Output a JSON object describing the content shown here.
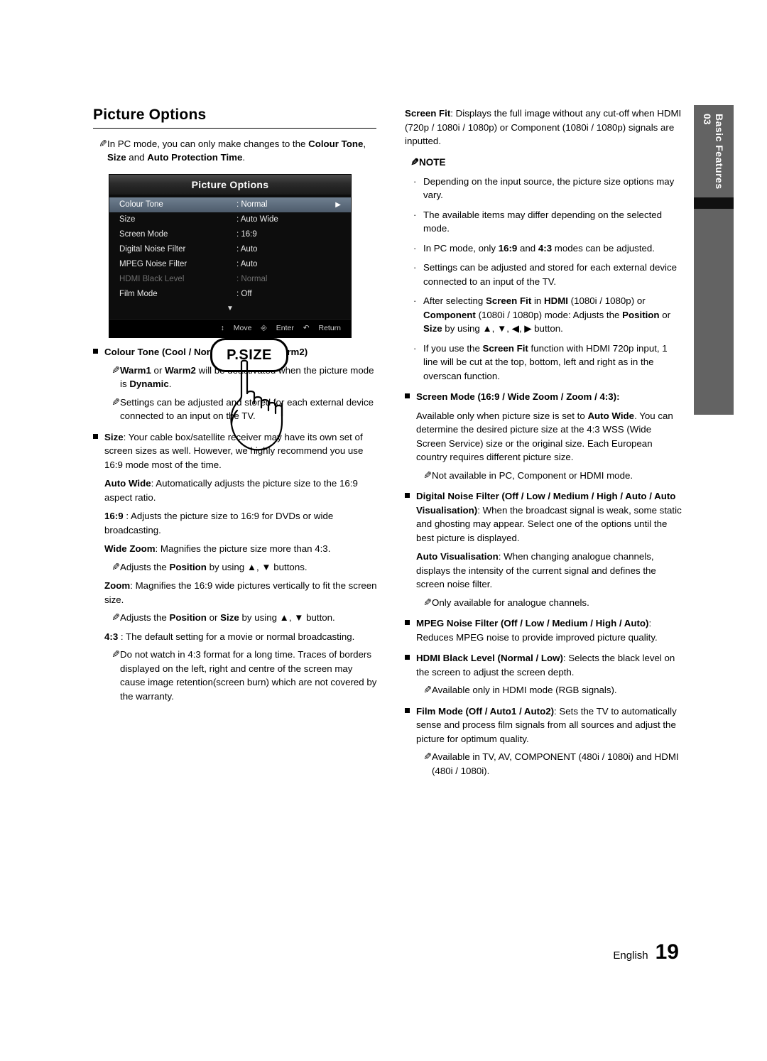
{
  "page": {
    "title": "Picture Options",
    "footer_label": "English",
    "page_number": "19",
    "side_tab_number": "03",
    "side_tab_text": "Basic Features"
  },
  "left": {
    "intro_note": "In PC mode, you can only make changes to the Colour Tone, Size and Auto Protection Time.",
    "osd": {
      "header": "Picture Options",
      "rows": [
        {
          "label": "Colour Tone",
          "value": ": Normal",
          "arrow": "▶",
          "state": "selected"
        },
        {
          "label": "Size",
          "value": ": Auto Wide",
          "arrow": "",
          "state": "normal"
        },
        {
          "label": "Screen Mode",
          "value": ": 16:9",
          "arrow": "",
          "state": "normal"
        },
        {
          "label": "Digital Noise Filter",
          "value": ": Auto",
          "arrow": "",
          "state": "normal"
        },
        {
          "label": "MPEG Noise Filter",
          "value": ": Auto",
          "arrow": "",
          "state": "normal"
        },
        {
          "label": "HDMI Black Level",
          "value": ": Normal",
          "arrow": "",
          "state": "dim"
        },
        {
          "label": "Film Mode",
          "value": ": Off",
          "arrow": "",
          "state": "normal"
        }
      ],
      "scroll_down": "▼",
      "footer": {
        "move": "Move",
        "enter": "Enter",
        "return": "Return"
      }
    },
    "colour_tone": {
      "heading": "Colour Tone (Cool / Normal / Warm1 / Warm2)",
      "note1": "Warm1 or Warm2 will be deactivated when the picture mode is Dynamic.",
      "note2": "Settings can be adjusted and stored for each external device connected to an input on the TV."
    },
    "size": {
      "heading": "Size: Your cable box/satellite receiver may have its own set of screen sizes as well. However, we highly recommend you use 16:9 mode most of the time.",
      "auto_wide": "Auto Wide: Automatically adjusts the picture size to the 16:9 aspect ratio.",
      "ratio_169": "16:9 : Adjusts the picture size to 16:9 for DVDs or wide broadcasting.",
      "wide_zoom": "Wide Zoom: Magnifies the picture size more than 4:3.",
      "wide_zoom_note": "Adjusts the Position by using ▲, ▼ buttons.",
      "zoom": "Zoom: Magnifies the 16:9 wide pictures vertically to fit the screen size.",
      "zoom_note": "Adjusts the Position or Size by using ▲, ▼ button.",
      "ratio_43": "4:3 : The default setting for a movie or normal broadcasting.",
      "ratio_43_note": "Do not watch in 4:3 format for a long time. Traces of borders displayed on the left, right and centre of the screen may cause image retention(screen burn) which are not covered by the warranty."
    },
    "remote_button_label": "P.SIZE"
  },
  "right": {
    "screen_fit": "Screen Fit: Displays the full image without any cut-off when HDMI (720p / 1080i / 1080p) or Component (1080i / 1080p) signals are inputted.",
    "note_heading": "NOTE",
    "notes": [
      "Depending on the input source, the picture size options may vary.",
      "The available items may differ depending on the selected mode.",
      "In PC mode, only 16:9 and 4:3 modes can be adjusted.",
      "Settings can be adjusted and stored for each external device connected to an input of the TV.",
      "After selecting Screen Fit in HDMI (1080i / 1080p) or Component (1080i / 1080p) mode: Adjusts the Position or Size by using ▲, ▼, ◀, ▶ button.",
      "If you use the Screen Fit function with HDMI 720p input, 1 line will be cut at the top, bottom, left and right as in the overscan function."
    ],
    "screen_mode": {
      "heading": "Screen Mode (16:9 / Wide Zoom / Zoom / 4:3):",
      "body": "Available only when picture size is set to Auto Wide. You can determine the desired picture size at the 4:3 WSS (Wide Screen Service) size or the original size. Each European country requires different picture size.",
      "note": "Not available in PC, Component or HDMI mode."
    },
    "digital_noise_filter": {
      "heading": "Digital Noise Filter (Off / Low / Medium / High / Auto / Auto Visualisation): When the broadcast signal is weak, some static and ghosting may appear. Select one of the options until the best picture is displayed.",
      "auto_vis": "Auto Visualisation: When changing analogue channels, displays the intensity of the current signal and defines the screen noise filter.",
      "note": "Only available for analogue channels."
    },
    "mpeg_noise_filter": {
      "heading": "MPEG Noise Filter (Off / Low / Medium / High / Auto): Reduces MPEG noise to provide improved picture quality."
    },
    "hdmi_black_level": {
      "heading": "HDMI Black Level (Normal / Low): Selects the black level on the screen to adjust the screen depth.",
      "note": "Available only in HDMI mode (RGB signals)."
    },
    "film_mode": {
      "heading": "Film Mode (Off / Auto1 / Auto2): Sets the TV to automatically sense and process film signals from all sources and adjust the picture for optimum quality.",
      "note": "Available in TV, AV, COMPONENT (480i / 1080i) and HDMI (480i / 1080i)."
    }
  }
}
